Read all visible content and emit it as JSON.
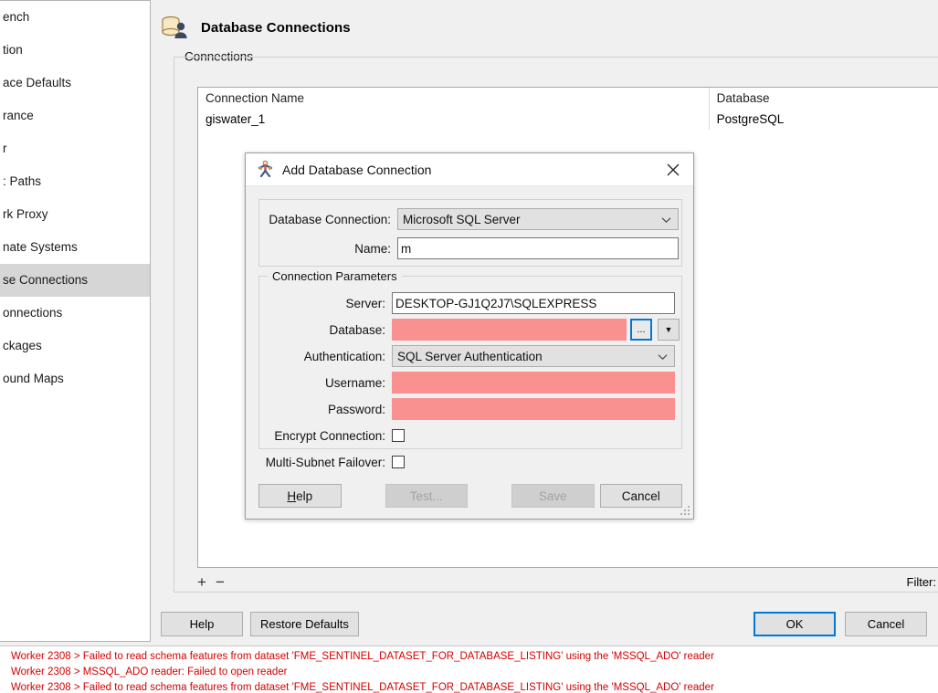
{
  "sidebar": {
    "items": [
      {
        "label": "ench",
        "selected": false
      },
      {
        "label": "tion",
        "selected": false
      },
      {
        "label": "ace Defaults",
        "selected": false
      },
      {
        "label": "rance",
        "selected": false
      },
      {
        "label": "r",
        "selected": false
      },
      {
        "label": ": Paths",
        "selected": false
      },
      {
        "label": "rk Proxy",
        "selected": false
      },
      {
        "label": "nate Systems",
        "selected": false
      },
      {
        "label": "se Connections",
        "selected": true
      },
      {
        "label": "onnections",
        "selected": false
      },
      {
        "label": "ckages",
        "selected": false
      },
      {
        "label": "ound Maps",
        "selected": false
      }
    ]
  },
  "page": {
    "title": "Database Connections",
    "title_icon": "database-user-icon"
  },
  "connections_group": {
    "legend": "Connections",
    "columns": [
      "Connection Name",
      "Database"
    ],
    "rows": [
      {
        "name": "giswater_1",
        "database": "PostgreSQL"
      }
    ],
    "add_button": "+",
    "remove_button": "−",
    "filter_label": "Filter:",
    "filter_value": "",
    "filter_placeholder": ""
  },
  "bottom_bar": {
    "help": "Help",
    "restore_defaults": "Restore Defaults",
    "ok": "OK",
    "cancel": "Cancel",
    "ok_accent_color": "#0078d7"
  },
  "dialog": {
    "title": "Add Database Connection",
    "title_icon": "fme-workbench-icon",
    "close_icon": "close-icon",
    "connection_group": {
      "labels": {
        "database_connection": "Database Connection:",
        "name": "Name:"
      },
      "database_connection_value": "Microsoft SQL Server",
      "name_value": "m",
      "name_placeholder": ""
    },
    "parameters_group": {
      "legend": "Connection Parameters",
      "labels": {
        "server": "Server:",
        "database": "Database:",
        "authentication": "Authentication:",
        "username": "Username:",
        "password": "Password:",
        "encrypt_connection": "Encrypt Connection:",
        "multi_subnet_failover": "Multi-Subnet Failover:"
      },
      "server_value": "DESKTOP-GJ1Q2J7\\SQLEXPRESS",
      "database_value": "",
      "authentication_value": "SQL Server Authentication",
      "username_value": "",
      "password_value": "",
      "encrypt_connection_checked": false,
      "multi_subnet_failover_checked": false,
      "browse_button": "...",
      "dropdown_button": "▼",
      "error_field_color": "#f99191"
    },
    "buttons": {
      "help": "Help",
      "help_mnemonic": "H",
      "test": "Test...",
      "save": "Save",
      "cancel": "Cancel",
      "test_disabled": true,
      "save_disabled": true
    }
  },
  "log": {
    "lines": [
      "Worker 2308 > Failed to read schema features from dataset 'FME_SENTINEL_DATASET_FOR_DATABASE_LISTING' using the 'MSSQL_ADO' reader",
      "Worker 2308 > MSSQL_ADO reader: Failed to open reader",
      "Worker 2308 > Failed to read schema features from dataset 'FME_SENTINEL_DATASET_FOR_DATABASE_LISTING' using the 'MSSQL_ADO' reader"
    ],
    "color": "#d40000"
  }
}
